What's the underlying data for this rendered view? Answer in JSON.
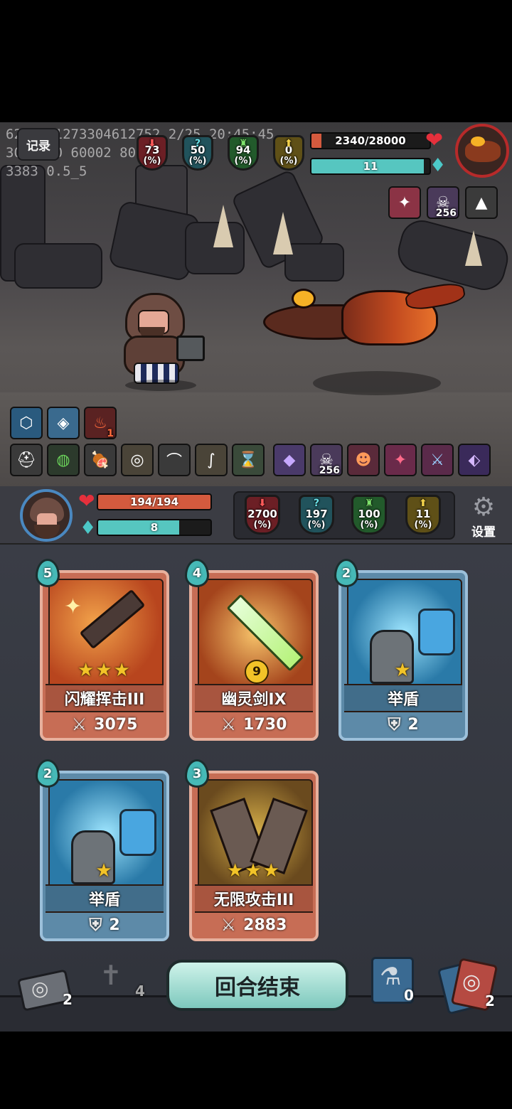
{
  "debug": {
    "line1": "6283241273304612752 2/25 20:45:45",
    "line2": "30001 0 60002 800",
    "line3": "3383 0.5_5"
  },
  "record_label": "记录",
  "enemy": {
    "stats": [
      {
        "value": "73",
        "unit": "(%)",
        "symbol": "⬇",
        "color": "#6c1f25"
      },
      {
        "value": "50",
        "unit": "(%)",
        "symbol": "?",
        "color": "#21535c"
      },
      {
        "value": "94",
        "unit": "(%)",
        "symbol": "♜",
        "color": "#225a2b"
      },
      {
        "value": "0",
        "unit": "(%)",
        "symbol": "⬆",
        "color": "#5f5017"
      }
    ],
    "hp_text": "2340/28000",
    "hp_fraction": 0.0836,
    "energy_text": "11",
    "energy_fraction": 0.95,
    "buffs": [
      {
        "icon": "armor-break-icon",
        "glyph": "✦",
        "count": ""
      },
      {
        "icon": "voodoo-doll-icon",
        "glyph": "☠",
        "count": "256"
      },
      {
        "icon": "spike-icon",
        "glyph": "▲",
        "count": ""
      }
    ]
  },
  "player_buffs_top": [
    {
      "icon": "shield-crystal-icon",
      "glyph": "⬡",
      "count": ""
    },
    {
      "icon": "water-drop-icon",
      "glyph": "◈",
      "count": ""
    },
    {
      "icon": "flame-icon",
      "glyph": "♨",
      "count": "1"
    }
  ],
  "relics": [
    {
      "icon": "gladiator-helmet-icon",
      "glyph": "⛑"
    },
    {
      "icon": "green-orb-icon",
      "glyph": "◍"
    },
    {
      "icon": "meat-icon",
      "glyph": "🍖"
    },
    {
      "icon": "nest-icon",
      "glyph": "◎"
    },
    {
      "icon": "trap-icon",
      "glyph": "⌒"
    },
    {
      "icon": "claw-icon",
      "glyph": "∫"
    },
    {
      "icon": "hourglass-icon",
      "glyph": "⌛"
    }
  ],
  "enemy_relics": [
    {
      "icon": "purple-gem-icon",
      "glyph": "◆",
      "count": ""
    },
    {
      "icon": "voodoo-doll-icon",
      "glyph": "☠",
      "count": "256"
    },
    {
      "icon": "demon-mask-icon",
      "glyph": "☻",
      "count": ""
    },
    {
      "icon": "armor-break-icon",
      "glyph": "✦",
      "count": ""
    },
    {
      "icon": "sword-shield-icon",
      "glyph": "⚔",
      "count": ""
    },
    {
      "icon": "crystal-shard-icon",
      "glyph": "⬖",
      "count": ""
    }
  ],
  "player": {
    "hp_text": "194/194",
    "hp_fraction": 1.0,
    "energy_text": "8",
    "energy_fraction": 0.72,
    "stats": [
      {
        "value": "2700",
        "unit": "(%)",
        "symbol": "⬇",
        "color": "#6c1f25"
      },
      {
        "value": "197",
        "unit": "(%)",
        "symbol": "?",
        "color": "#21535c"
      },
      {
        "value": "100",
        "unit": "(%)",
        "symbol": "♜",
        "color": "#225a2b"
      },
      {
        "value": "11",
        "unit": "(%)",
        "symbol": "⬆",
        "color": "#5f5017"
      }
    ],
    "settings_label": "设置"
  },
  "cards": [
    {
      "cost": "5",
      "name": "闪耀挥击III",
      "stars": "★★★",
      "value": "3075",
      "type": "attack",
      "level": ""
    },
    {
      "cost": "4",
      "name": "幽灵剑IX",
      "stars": "",
      "value": "1730",
      "type": "attack",
      "level": "9"
    },
    {
      "cost": "2",
      "name": "举盾",
      "stars": "★",
      "value": "2",
      "type": "block",
      "level": ""
    },
    {
      "cost": "2",
      "name": "举盾",
      "stars": "★",
      "value": "2",
      "type": "block",
      "level": ""
    },
    {
      "cost": "3",
      "name": "无限攻击III",
      "stars": "★★★",
      "value": "2883",
      "type": "attack",
      "level": ""
    }
  ],
  "bottom": {
    "draw_pile_count": "2",
    "grave_count": "4",
    "end_turn_label": "回合结束",
    "potion_count": "0",
    "discard_count": "2"
  }
}
